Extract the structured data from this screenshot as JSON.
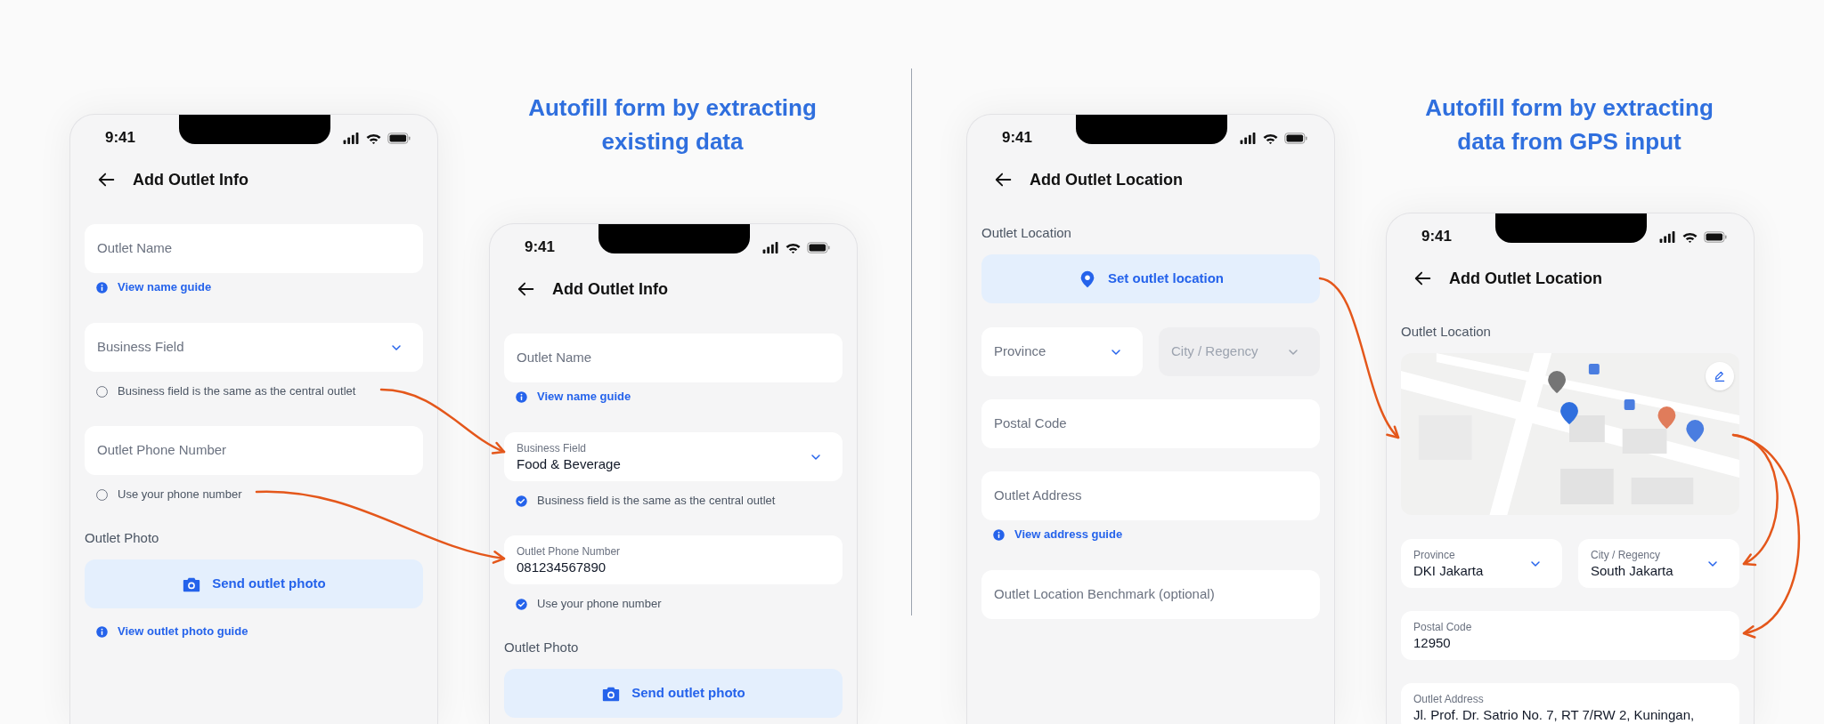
{
  "sections": [
    {
      "heading_lines": [
        "Autofill form by extracting",
        "existing data"
      ],
      "screens": [
        {
          "time": "9:41",
          "title": "Add Outlet Info",
          "items": [
            {
              "kind": "field",
              "label": "Outlet Name"
            },
            {
              "kind": "link",
              "label": "View name guide"
            },
            {
              "kind": "select",
              "label": "Business Field"
            },
            {
              "kind": "option",
              "label": "Business field is the same as the central outlet",
              "checked": false
            },
            {
              "kind": "field",
              "label": "Outlet Phone Number"
            },
            {
              "kind": "option",
              "label": "Use your phone number",
              "checked": false
            },
            {
              "kind": "label",
              "text": "Outlet Photo"
            },
            {
              "kind": "photo_button",
              "label": "Send outlet photo"
            },
            {
              "kind": "link",
              "label": "View outlet photo guide"
            }
          ]
        },
        {
          "time": "9:41",
          "title": "Add Outlet Info",
          "items": [
            {
              "kind": "field",
              "label": "Outlet Name"
            },
            {
              "kind": "link",
              "label": "View name guide"
            },
            {
              "kind": "select",
              "label": "Business Field",
              "value": "Food & Beverage"
            },
            {
              "kind": "option",
              "label": "Business field is the same as the central outlet",
              "checked": true
            },
            {
              "kind": "field",
              "label": "Outlet Phone Number",
              "value": "081234567890"
            },
            {
              "kind": "option",
              "label": "Use your phone number",
              "checked": true
            },
            {
              "kind": "label",
              "text": "Outlet Photo"
            },
            {
              "kind": "photo_button",
              "label": "Send outlet photo"
            }
          ]
        }
      ]
    },
    {
      "heading_lines": [
        "Autofill form by extracting",
        "data from GPS input"
      ],
      "screens": [
        {
          "time": "9:41",
          "title": "Add Outlet Location",
          "items": [
            {
              "kind": "label",
              "text": "Outlet Location"
            },
            {
              "kind": "location_button",
              "label": "Set outlet location"
            },
            {
              "kind": "pair",
              "fields": [
                {
                  "label": "Province",
                  "disabled": false
                },
                {
                  "label": "City / Regency",
                  "disabled": true
                }
              ]
            },
            {
              "kind": "field",
              "label": "Postal Code"
            },
            {
              "kind": "field",
              "label": "Outlet Address"
            },
            {
              "kind": "link",
              "label": "View address guide"
            },
            {
              "kind": "field",
              "label": "Outlet Location Benchmark (optional)"
            }
          ]
        },
        {
          "time": "9:41",
          "title": "Add Outlet Location",
          "items": [
            {
              "kind": "label",
              "text": "Outlet Location"
            },
            {
              "kind": "map"
            },
            {
              "kind": "pair",
              "fields": [
                {
                  "label": "Province",
                  "value": "DKI Jakarta",
                  "disabled": false
                },
                {
                  "label": "City / Regency",
                  "value": "South Jakarta",
                  "disabled": false
                }
              ]
            },
            {
              "kind": "field",
              "label": "Postal Code",
              "value": "12950"
            },
            {
              "kind": "field",
              "label": "Outlet Address",
              "value": "Jl. Prof. Dr. Satrio No. 7, RT 7/RW 2, Kuningan,"
            }
          ]
        }
      ]
    }
  ]
}
